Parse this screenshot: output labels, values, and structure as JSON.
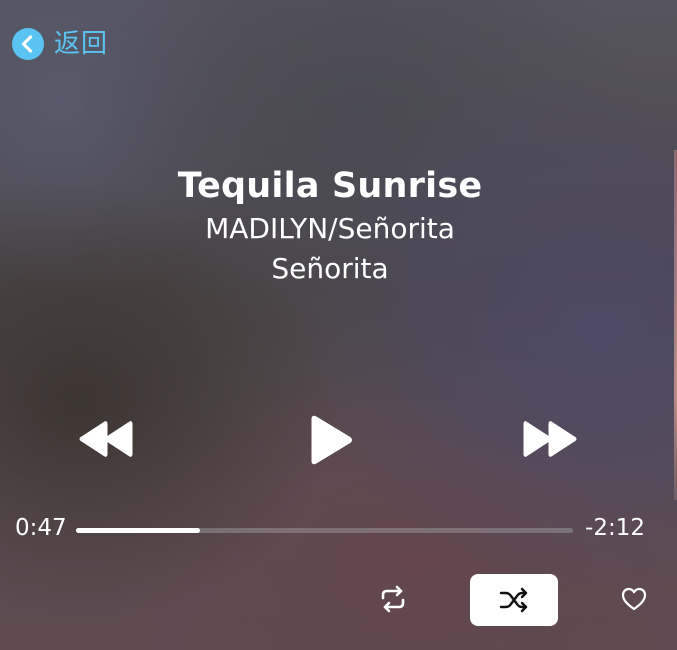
{
  "nav": {
    "back_label": "返回",
    "back_icon": "chevron-left-circle-icon",
    "accent_color": "#5ac3f2"
  },
  "track": {
    "title": "Tequila Sunrise",
    "artist": "MADILYN/Señorita",
    "album": "Señorita"
  },
  "playback": {
    "elapsed": "0:47",
    "remaining": "-2:12",
    "progress_fraction": 0.25,
    "state": "paused"
  },
  "controls": {
    "rewind_icon": "rewind-icon",
    "play_icon": "play-icon",
    "forward_icon": "fast-forward-icon",
    "repeat_icon": "repeat-icon",
    "shuffle_icon": "shuffle-icon",
    "shuffle_active": true,
    "favorite_icon": "heart-outline-icon"
  }
}
